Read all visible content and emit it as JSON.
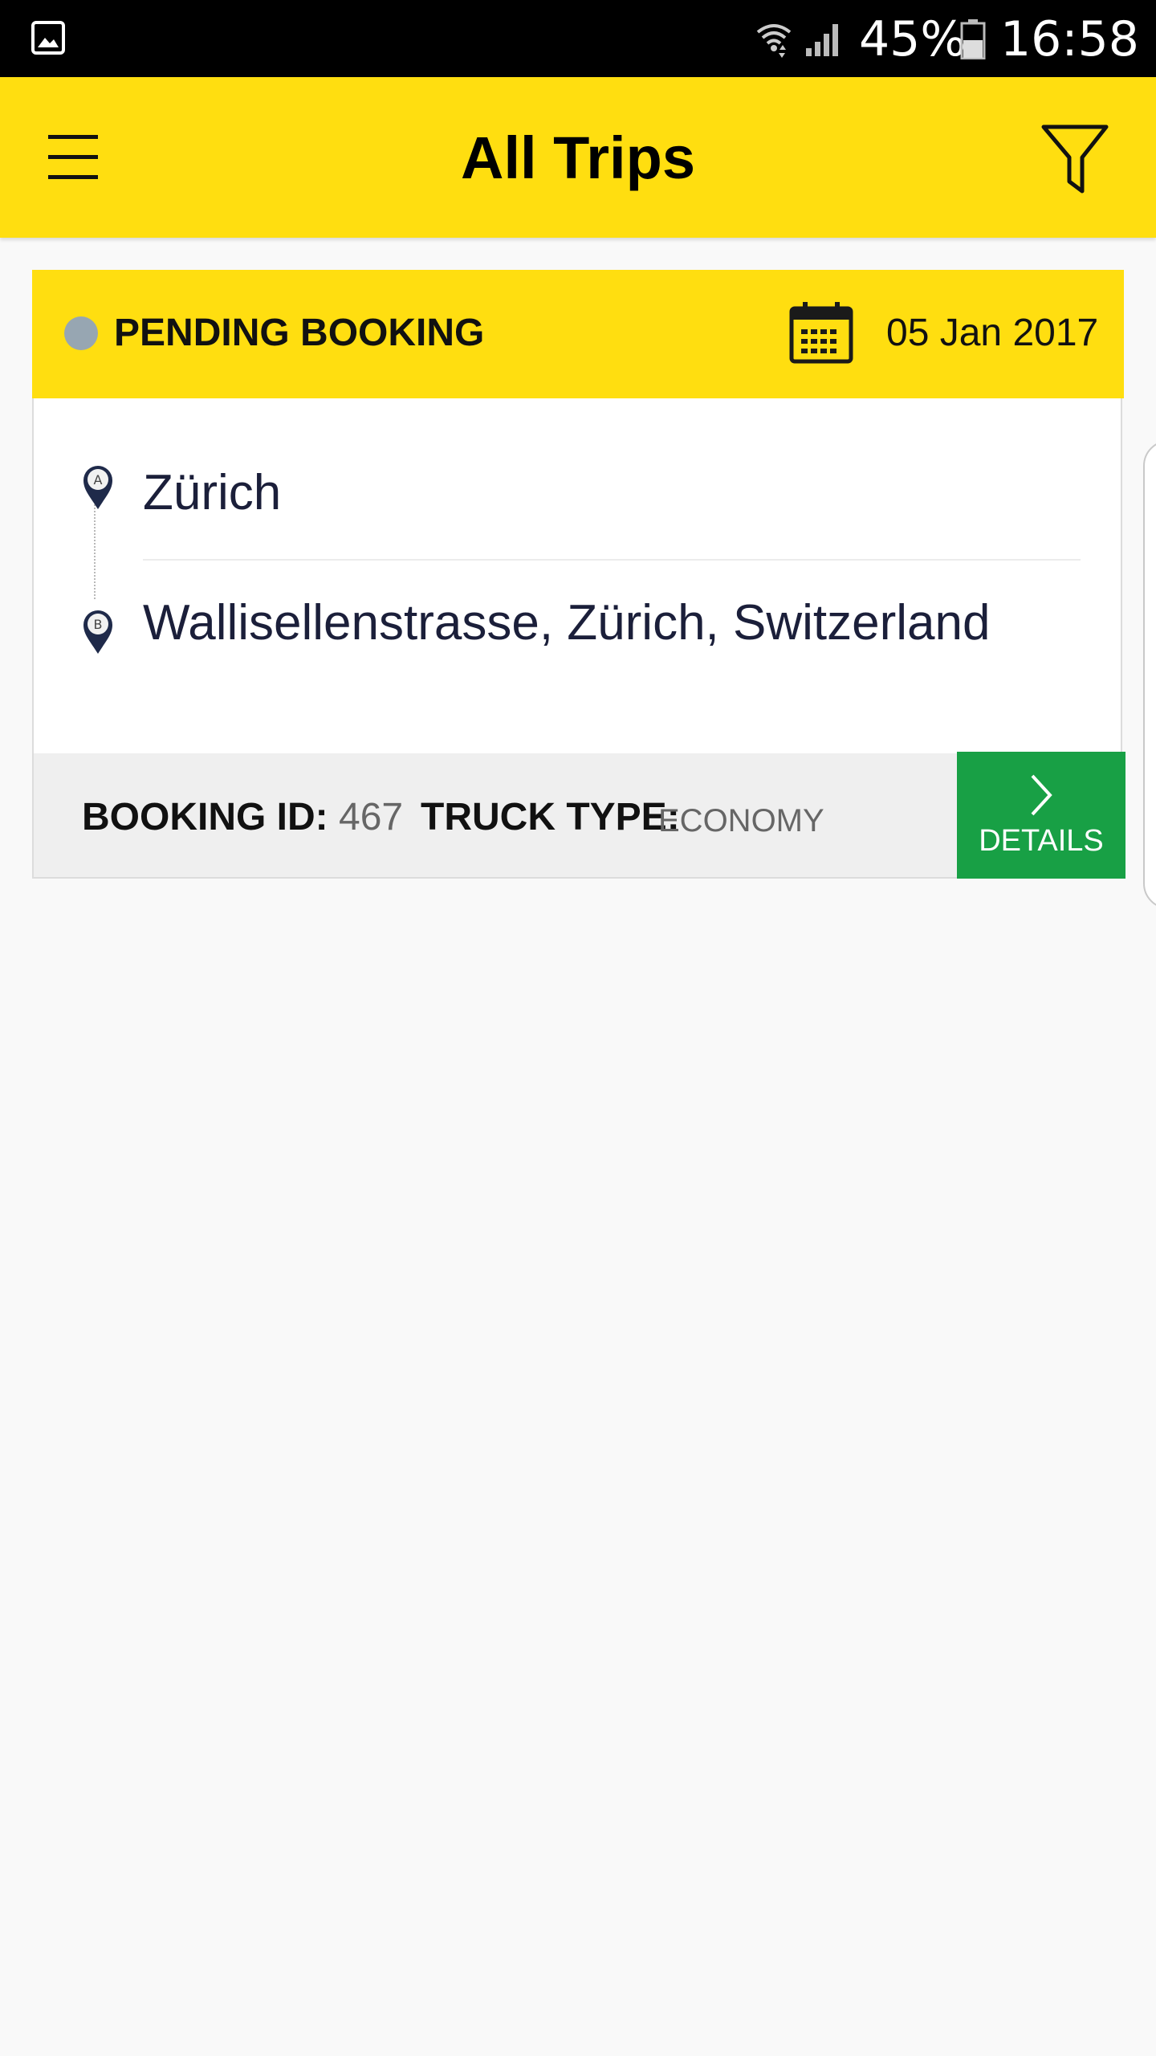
{
  "status_bar": {
    "battery_percent": "45%",
    "time": "16:58",
    "icons": [
      "gallery-icon",
      "wifi-icon",
      "signal-icon",
      "battery-icon"
    ]
  },
  "app_bar": {
    "title": "All Trips",
    "menu_icon": "hamburger-menu-icon",
    "filter_icon": "filter-funnel-icon"
  },
  "trip": {
    "status": "PENDING BOOKING",
    "status_color": "#97a6b2",
    "date": "05 Jan 2017",
    "pickup": {
      "marker": "A",
      "location": "Zürich"
    },
    "dropoff": {
      "marker": "B",
      "location": "Wallisellenstrasse, Zürich, Switzerland"
    },
    "booking_id_label": "BOOKING ID",
    "booking_id": "467",
    "truck_type_label": "TRUCK TYPE",
    "truck_type": "ECONOMY",
    "details_label": "DETAILS"
  },
  "colors": {
    "brand_yellow": "#ffde10",
    "details_green": "#18a045",
    "background": "#f9f9f9"
  }
}
